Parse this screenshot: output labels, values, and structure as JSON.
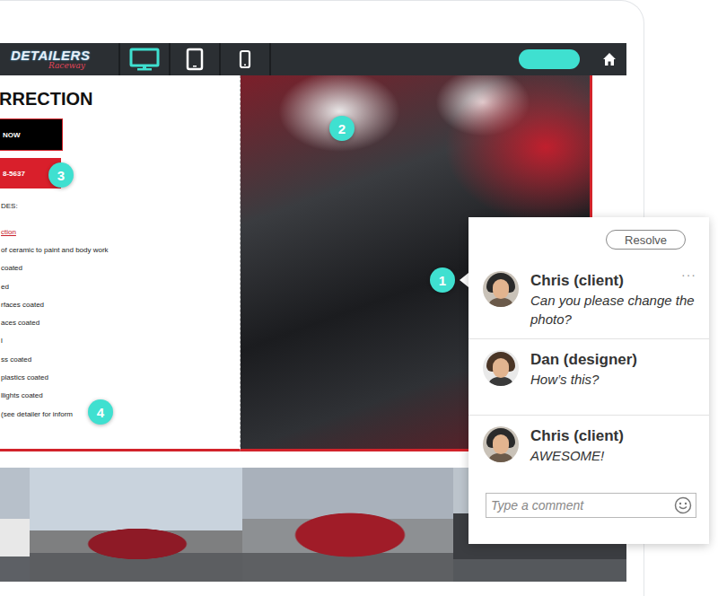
{
  "header": {
    "logo": "DETAILERS",
    "logo_sub": "Raceway",
    "devices": [
      {
        "kind": "desktop",
        "selected": true
      },
      {
        "kind": "tablet",
        "selected": false
      },
      {
        "kind": "phone",
        "selected": false
      }
    ]
  },
  "page": {
    "heading": "RRECTION",
    "buttons": [
      {
        "label": "NOW",
        "kind": "dark"
      },
      {
        "label": "8-5637",
        "kind": "red"
      }
    ],
    "label": "DES:",
    "link": "ction",
    "items": [
      "of ceramic to paint and body work",
      "coated",
      "ed",
      "rfaces coated",
      "aces coated",
      "l",
      "ss coated",
      "plastics coated",
      "llights coated",
      "(see detailer for inform"
    ]
  },
  "markers": [
    "1",
    "2",
    "3",
    "4"
  ],
  "comments": {
    "resolve": "Resolve",
    "more": "···",
    "items": [
      {
        "author": "Chris (client)",
        "text": "Can you please change the photo?"
      },
      {
        "author": "Dan (designer)",
        "text": "How’s this?"
      },
      {
        "author": "Chris (client)",
        "text": "AWESOME!"
      }
    ],
    "input": {
      "placeholder": "Type a comment"
    }
  }
}
